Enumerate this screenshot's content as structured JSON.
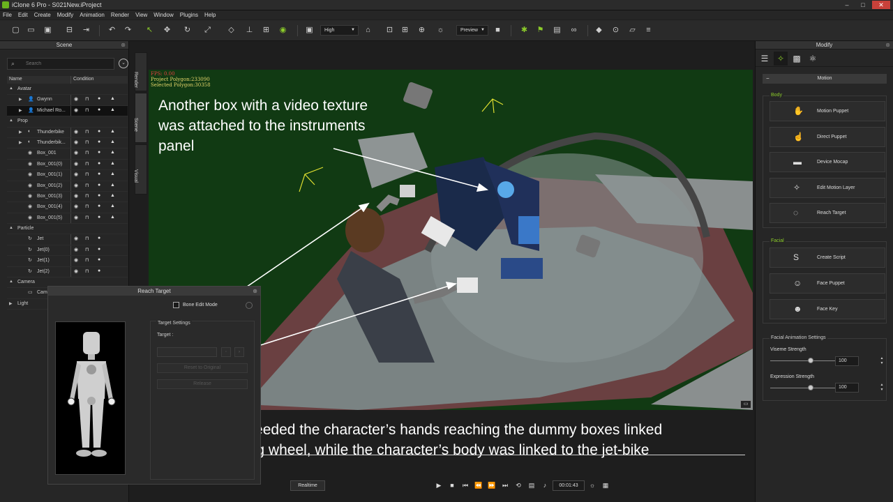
{
  "window": {
    "title": "iClone 6 Pro - S021New.iProject",
    "min": "–",
    "max": "□",
    "close": "✕"
  },
  "menu": [
    "File",
    "Edit",
    "Create",
    "Modify",
    "Animation",
    "Render",
    "View",
    "Window",
    "Plugins",
    "Help"
  ],
  "toolbar": {
    "quality_select": "High",
    "preview_select": "Preview"
  },
  "scene": {
    "title": "Scene",
    "search_placeholder": "Search",
    "col_name": "Name",
    "col_condition": "Condition",
    "rows": [
      {
        "label": "Avatar",
        "kind": "group"
      },
      {
        "label": "Gwynn",
        "kind": "avatar"
      },
      {
        "label": "Michael Ro...",
        "kind": "avatar",
        "selected": true
      },
      {
        "label": "Prop",
        "kind": "group"
      },
      {
        "label": "Thunderbike",
        "kind": "prop"
      },
      {
        "label": "Thunderbik...",
        "kind": "prop"
      },
      {
        "label": "Box_001",
        "kind": "box"
      },
      {
        "label": "Box_001(0)",
        "kind": "box"
      },
      {
        "label": "Box_001(1)",
        "kind": "box"
      },
      {
        "label": "Box_001(2)",
        "kind": "box"
      },
      {
        "label": "Box_001(3)",
        "kind": "box"
      },
      {
        "label": "Box_001(4)",
        "kind": "box"
      },
      {
        "label": "Box_001(5)",
        "kind": "box"
      },
      {
        "label": "Particle",
        "kind": "group"
      },
      {
        "label": "Jet",
        "kind": "particle"
      },
      {
        "label": "Jet(0)",
        "kind": "particle"
      },
      {
        "label": "Jet(1)",
        "kind": "particle"
      },
      {
        "label": "Jet(2)",
        "kind": "particle"
      },
      {
        "label": "Camera",
        "kind": "group"
      },
      {
        "label": "Cam",
        "kind": "camera"
      },
      {
        "label": "Light",
        "kind": "group-collapsed"
      }
    ]
  },
  "side_tabs": [
    "Render",
    "Scene",
    "Visual"
  ],
  "viewport": {
    "fps": "FPS: 0.00",
    "project_polygon": "Project Polygon:233090",
    "selected_polygon": "Selected Polygon:30358"
  },
  "annotations": {
    "top": "Another box with a video texture was attached to the instruments panel",
    "bottom_line1": "Here, I just needed the character’s hands reaching the dummy boxes linked",
    "bottom_line2": "to the steering wheel, while the character’s body was linked to the jet-bike"
  },
  "reach_dialog": {
    "title": "Reach Target",
    "bone_edit_mode": "Bone Edit Mode",
    "target_settings": "Target Settings",
    "target_label": "Target :",
    "reset_label": "Reset to Original",
    "release_label": "Release"
  },
  "playback": {
    "realtime": "Realtime",
    "timecode": "00:01:43"
  },
  "modify": {
    "title": "Modify",
    "section": "Motion",
    "body_label": "Body",
    "body_buttons": [
      "Motion Puppet",
      "Direct Puppet",
      "Device Mocap",
      "Edit Motion Layer",
      "Reach Target"
    ],
    "facial_label": "Facial",
    "facial_buttons": [
      "Create Script",
      "Face Puppet",
      "Face Key"
    ],
    "fas_label": "Facial Animation Settings",
    "viseme_label": "Viseme Strength",
    "viseme_value": "100",
    "expression_label": "Expression Strength",
    "expression_value": "100"
  },
  "colors": {
    "accent_green": "#8ccc2a",
    "viewport_bg": "#113a13",
    "fps_red": "#e04040",
    "stats_yellow": "#e4d56a"
  }
}
